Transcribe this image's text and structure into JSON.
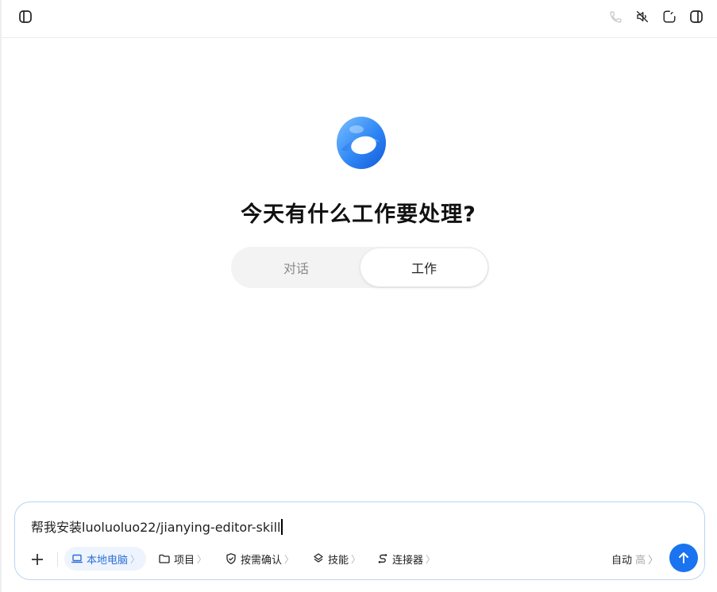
{
  "topbar": {
    "icons": [
      "sidebar-toggle-icon",
      "phone-icon",
      "mute-icon",
      "new-chat-icon",
      "panel-toggle-icon"
    ]
  },
  "main": {
    "headline": "今天有什么工作要处理?",
    "modes": [
      {
        "label": "对话",
        "selected": false
      },
      {
        "label": "工作",
        "selected": true
      }
    ]
  },
  "composer": {
    "input_value": "帮我安装luoluoluo22/jianying-editor-skill",
    "chips": [
      {
        "label": "本地电脑",
        "icon": "laptop-icon",
        "active": true
      },
      {
        "label": "项目",
        "icon": "folder-icon",
        "active": false
      },
      {
        "label": "按需确认",
        "icon": "shield-check-icon",
        "active": false
      },
      {
        "label": "技能",
        "icon": "layers-icon",
        "active": false
      },
      {
        "label": "连接器",
        "icon": "connector-icon",
        "active": false
      }
    ],
    "chevron": "〉",
    "auto_label": "自动",
    "level_label": "高",
    "accent_color": "#1a73f0"
  }
}
